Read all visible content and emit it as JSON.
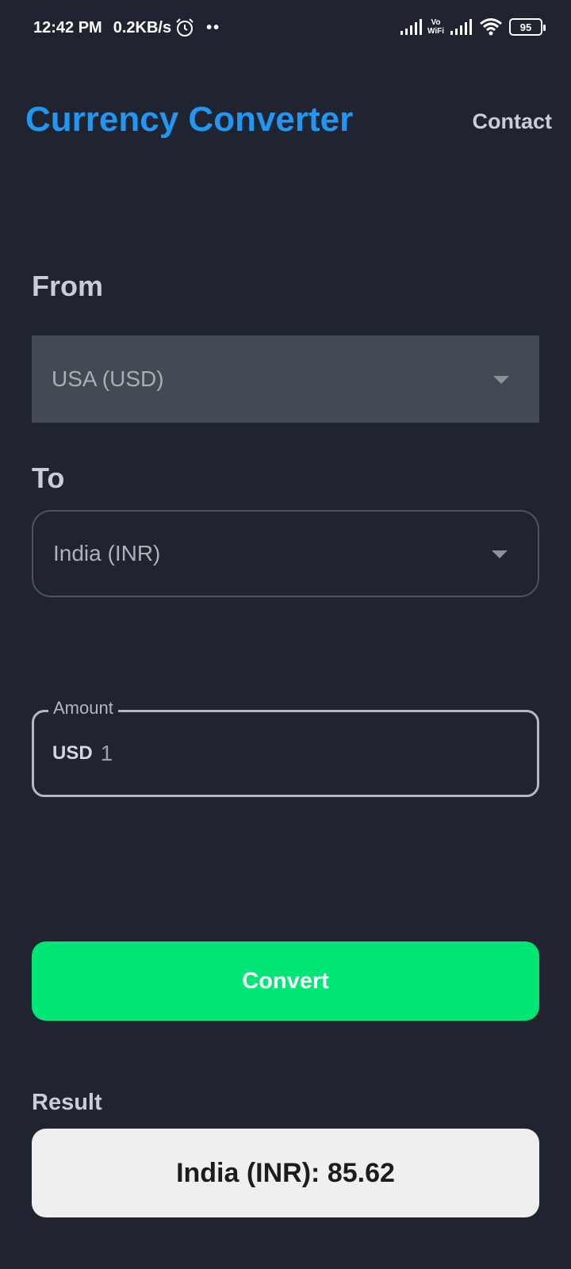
{
  "status_bar": {
    "time": "12:42 PM",
    "network_speed": "0.2KB/s",
    "notification_dots": "••",
    "vowifi_top": "Vo",
    "vowifi_bottom": "WiFi",
    "battery": "95"
  },
  "header": {
    "title": "Currency Converter",
    "contact_label": "Contact"
  },
  "from": {
    "label": "From",
    "selected": "USA (USD)"
  },
  "to": {
    "label": "To",
    "selected": "India (INR)"
  },
  "amount": {
    "label": "Amount",
    "currency_prefix": "USD",
    "value": "1"
  },
  "convert_label": "Convert",
  "result": {
    "label": "Result",
    "text": "India (INR): 85.62"
  },
  "colors": {
    "background": "#1f2430",
    "title": "#2196f3",
    "convert_button": "#00e676",
    "result_card": "#efefef"
  }
}
